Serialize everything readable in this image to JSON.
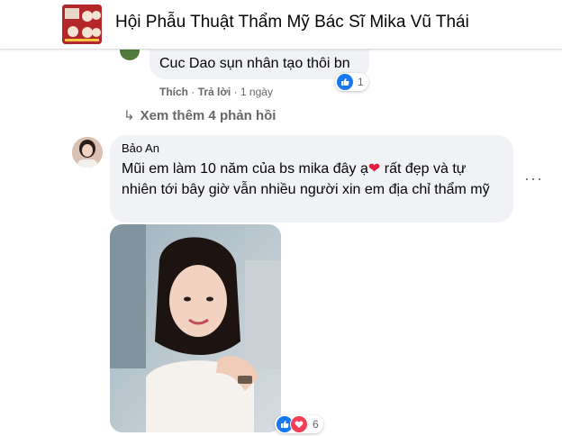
{
  "header": {
    "group_name": "Hội Phẫu Thuật Thẩm Mỹ Bác Sĩ Mika Vũ Thái"
  },
  "reply": {
    "text": "Cuc Dao sụn nhân tạo thôi bn",
    "like_label": "Thích",
    "reply_label": "Trả lời",
    "time": "1 ngày",
    "reaction_count": "1"
  },
  "view_more": {
    "label": "Xem thêm 4 phản hồi"
  },
  "comment": {
    "author": "Bảo An",
    "text_before_heart": "Mũi em làm 10 năm của bs mika đây ạ",
    "text_after_heart": " rất đẹp và tự nhiên tới bây giờ vẫn nhiều người xin em địa chỉ thẩm mỹ",
    "more_label": "···",
    "photo_reaction_count": "6"
  },
  "colors": {
    "accent": "#1877f2",
    "love": "#f33e58",
    "secondary_text": "#65676b",
    "bubble": "#f0f2f5"
  },
  "icons": {
    "like": "thumbs-up-icon",
    "love": "heart-icon",
    "arrow": "reply-arrow-icon",
    "more": "more-dots-icon"
  }
}
